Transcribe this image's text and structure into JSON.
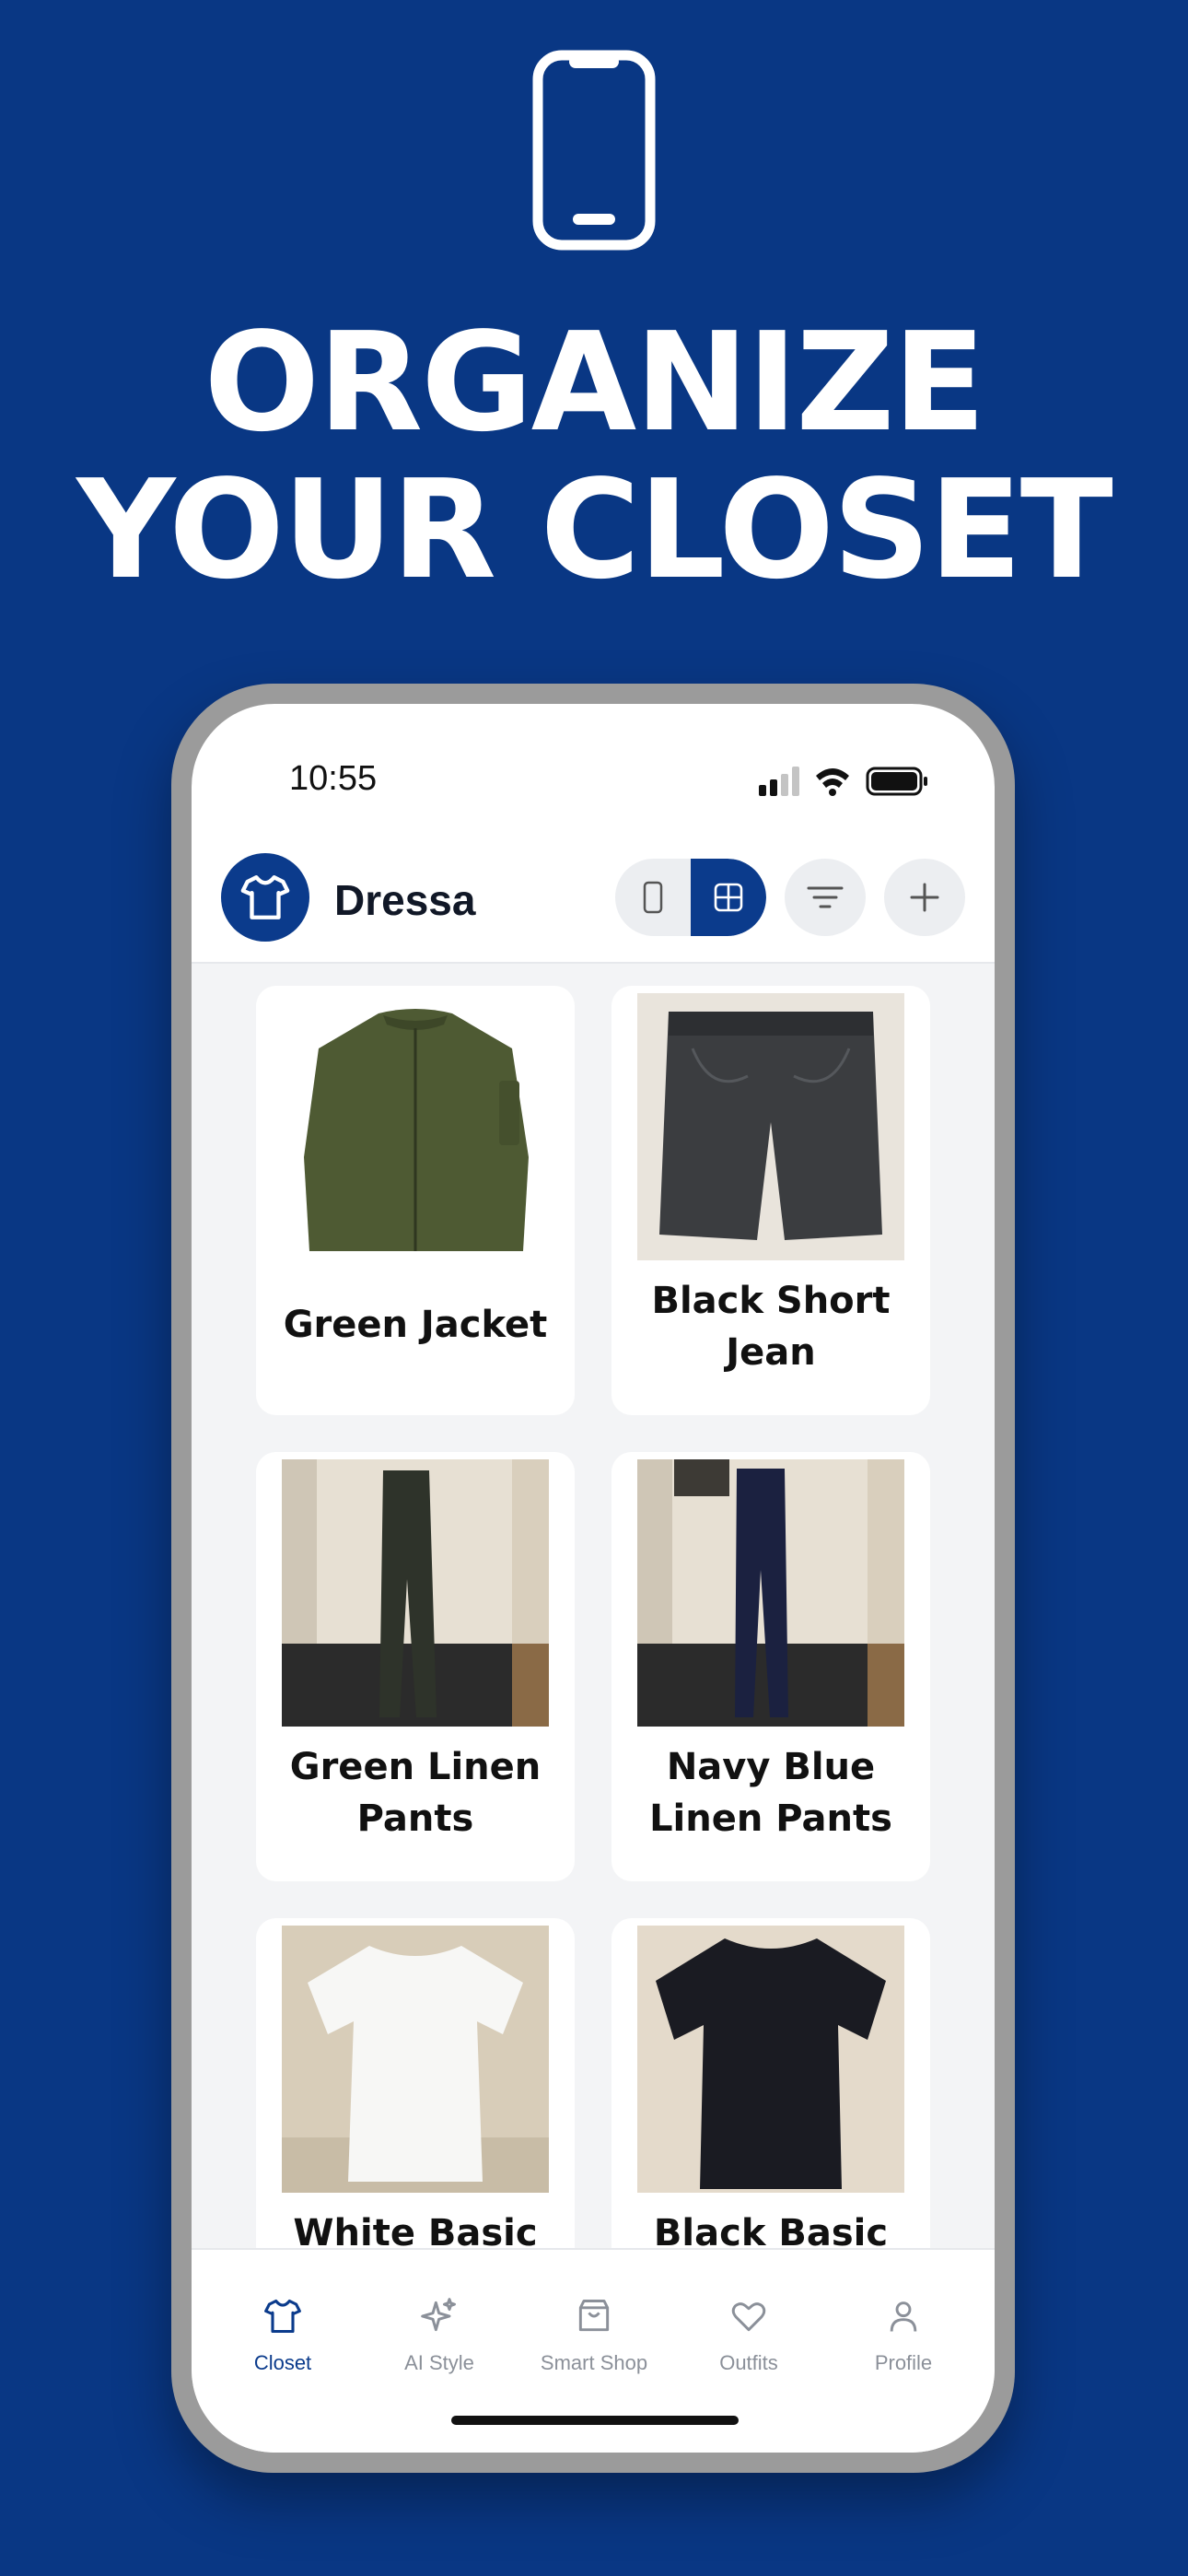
{
  "headline": {
    "line1": "ORGANIZE",
    "line2": "YOUR CLOSET"
  },
  "status_bar": {
    "time": "10:55"
  },
  "app": {
    "name": "Dressa",
    "accent_color": "#0b3b8c",
    "background_color": "#093784"
  },
  "toolbar": {
    "view_single_icon": "phone-icon",
    "view_grid_icon": "grid-icon",
    "filter_icon": "filter-icon",
    "add_icon": "plus-icon",
    "active_view": "grid"
  },
  "items": [
    {
      "name": "Green Jacket"
    },
    {
      "name": "Black Short Jean"
    },
    {
      "name": "Green Linen Pants"
    },
    {
      "name": "Navy Blue Linen Pants"
    },
    {
      "name": "White Basic"
    },
    {
      "name": "Black Basic"
    }
  ],
  "tabs": [
    {
      "label": "Closet",
      "icon": "shirt-icon",
      "active": true
    },
    {
      "label": "AI Style",
      "icon": "sparkles-icon",
      "active": false
    },
    {
      "label": "Smart Shop",
      "icon": "shopping-bag-icon",
      "active": false
    },
    {
      "label": "Outfits",
      "icon": "heart-icon",
      "active": false
    },
    {
      "label": "Profile",
      "icon": "user-icon",
      "active": false
    }
  ]
}
